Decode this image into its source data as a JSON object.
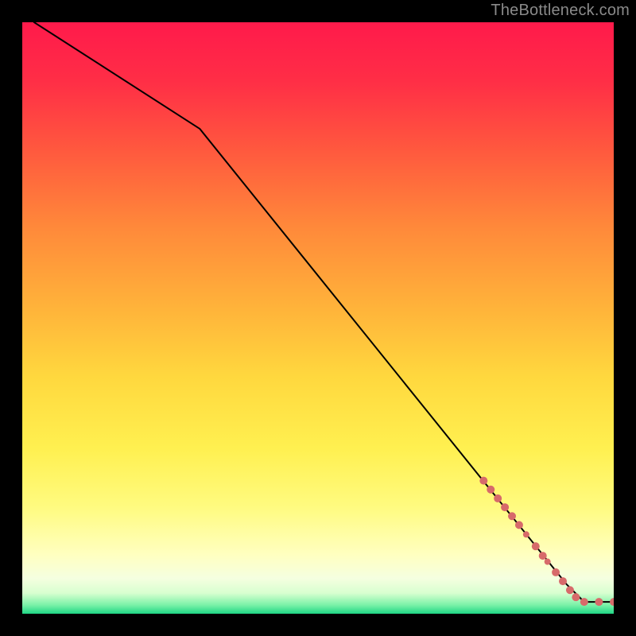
{
  "watermark": "TheBottleneck.com",
  "colors": {
    "frame": "#000000",
    "line": "#000000",
    "dot": "#d76a6a",
    "gradient_stops": [
      {
        "offset": 0.0,
        "color": "#ff1a4b"
      },
      {
        "offset": 0.1,
        "color": "#ff2e46"
      },
      {
        "offset": 0.22,
        "color": "#ff5a3e"
      },
      {
        "offset": 0.35,
        "color": "#ff8a3a"
      },
      {
        "offset": 0.48,
        "color": "#ffb23a"
      },
      {
        "offset": 0.6,
        "color": "#ffd83e"
      },
      {
        "offset": 0.72,
        "color": "#fff050"
      },
      {
        "offset": 0.82,
        "color": "#fffb80"
      },
      {
        "offset": 0.9,
        "color": "#ffffc0"
      },
      {
        "offset": 0.94,
        "color": "#f5ffe0"
      },
      {
        "offset": 0.965,
        "color": "#d8ffd0"
      },
      {
        "offset": 0.985,
        "color": "#7cf2a8"
      },
      {
        "offset": 1.0,
        "color": "#1fd685"
      }
    ]
  },
  "chart_data": {
    "type": "line",
    "title": "",
    "xlabel": "",
    "ylabel": "",
    "xlim": [
      0,
      100
    ],
    "ylim": [
      0,
      100
    ],
    "grid": false,
    "legend": false,
    "series": [
      {
        "name": "curve",
        "points": [
          {
            "x": 2,
            "y": 100
          },
          {
            "x": 30,
            "y": 82
          },
          {
            "x": 92,
            "y": 5
          },
          {
            "x": 95,
            "y": 2
          },
          {
            "x": 100,
            "y": 2
          }
        ]
      }
    ],
    "scatter": [
      {
        "x": 78.0,
        "y": 22.5,
        "r": 5
      },
      {
        "x": 79.2,
        "y": 21.0,
        "r": 5
      },
      {
        "x": 80.4,
        "y": 19.5,
        "r": 5
      },
      {
        "x": 81.6,
        "y": 18.0,
        "r": 5
      },
      {
        "x": 82.8,
        "y": 16.5,
        "r": 5
      },
      {
        "x": 84.0,
        "y": 15.0,
        "r": 5
      },
      {
        "x": 85.2,
        "y": 13.4,
        "r": 4
      },
      {
        "x": 86.8,
        "y": 11.4,
        "r": 5
      },
      {
        "x": 88.0,
        "y": 9.8,
        "r": 5
      },
      {
        "x": 88.8,
        "y": 8.8,
        "r": 4
      },
      {
        "x": 90.2,
        "y": 7.0,
        "r": 5
      },
      {
        "x": 91.4,
        "y": 5.5,
        "r": 5
      },
      {
        "x": 92.6,
        "y": 4.0,
        "r": 5
      },
      {
        "x": 93.6,
        "y": 2.8,
        "r": 5
      },
      {
        "x": 95.0,
        "y": 2.0,
        "r": 5
      },
      {
        "x": 97.5,
        "y": 2.0,
        "r": 5
      },
      {
        "x": 100.0,
        "y": 2.0,
        "r": 5
      }
    ]
  }
}
